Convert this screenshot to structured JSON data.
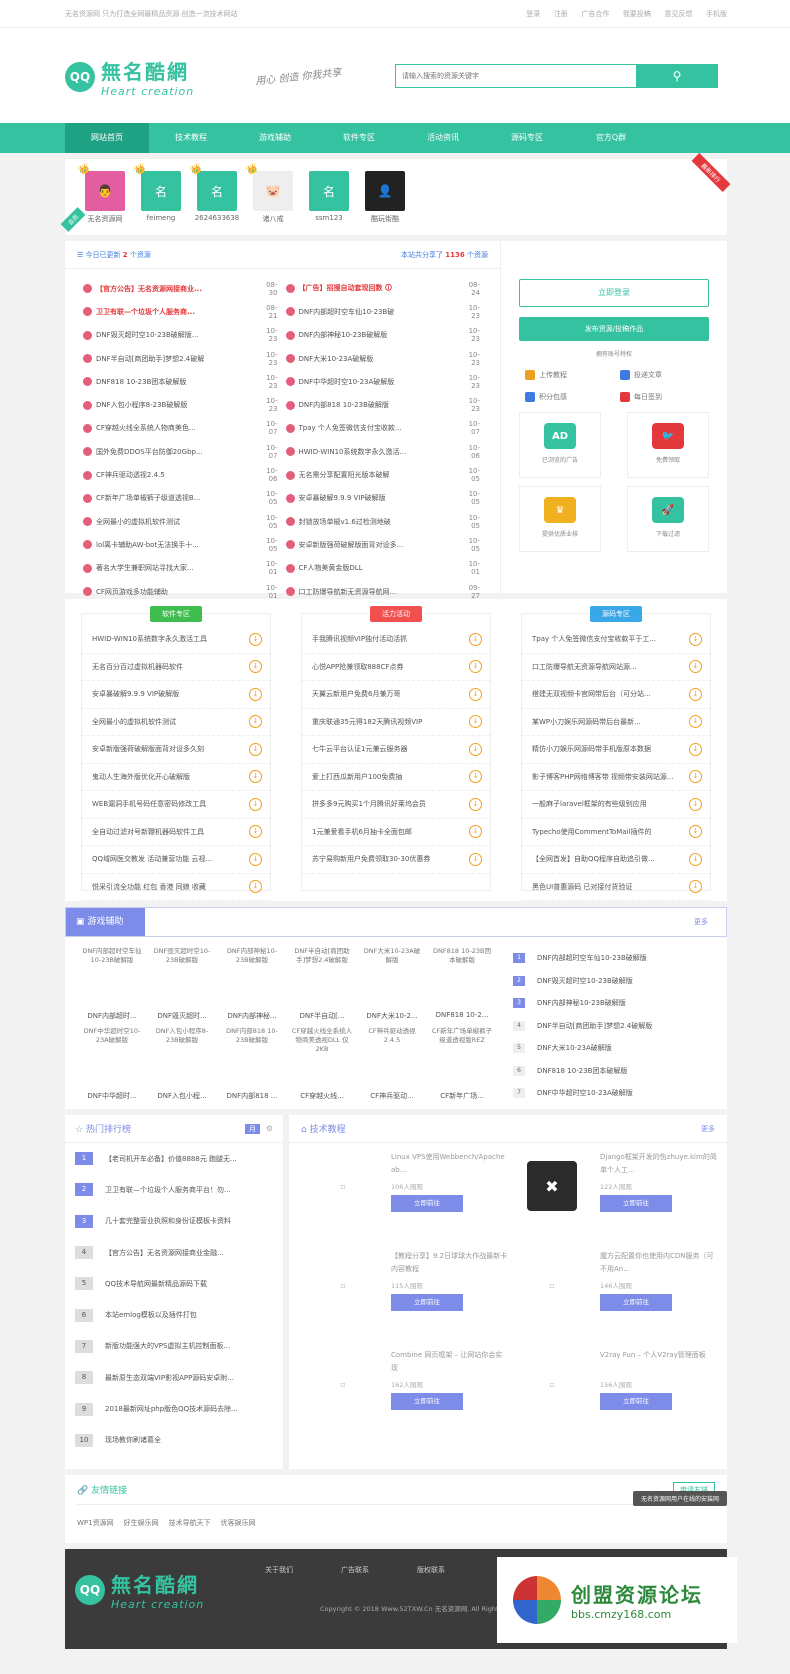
{
  "topbar": {
    "slogan": "无名资源网 只为打造全网最精品资源 创造一流技术网站",
    "links": [
      "登录",
      "注册",
      "广告合作",
      "我要投稿",
      "意见反馈",
      "手机版"
    ]
  },
  "logo": {
    "badge": "QQ",
    "cn": "無名酷網",
    "en": "Heart creation"
  },
  "motto": "用心 创造 你我共享",
  "search": {
    "placeholder": "请输入搜索的资源关键字",
    "icon": "search-icon"
  },
  "nav": {
    "items": [
      "网站首页",
      "技术教程",
      "游戏辅助",
      "软件专区",
      "活动资讯",
      "源码专区",
      "官方Q群"
    ],
    "active": 0
  },
  "users": {
    "ribbon": "最新排行",
    "corner": "会员",
    "items": [
      {
        "name": "无名资源网",
        "avatar": "👨"
      },
      {
        "name": "feimeng",
        "avatar": "名"
      },
      {
        "name": "2624633638",
        "avatar": "名"
      },
      {
        "name": "诸八戒",
        "avatar": "🐷"
      },
      {
        "name": "ssm123",
        "avatar": "名"
      },
      {
        "name": "酷玩街酷",
        "avatar": "👤"
      }
    ]
  },
  "update": {
    "today_prefix": "今日已更新",
    "today_count": "2",
    "today_suffix": "个资源",
    "total_prefix": "本站共分享了",
    "total_count": "1136",
    "total_suffix": "个资源",
    "left": [
      {
        "t": "【官方公告】无名资源网接商业...",
        "d": "08-30",
        "red": true
      },
      {
        "t": "卫卫有联—个垃圾个人服务商...",
        "d": "08-21",
        "red": true
      },
      {
        "t": "DNF毁灭超时空10-23B破解版...",
        "d": "10-23"
      },
      {
        "t": "DNF半自动[商团助手]梦想2.4破解",
        "d": "10-23"
      },
      {
        "t": "DNF818 10-23B团本破解版",
        "d": "10-23"
      },
      {
        "t": "DNF入包小程序8-23B破解版",
        "d": "10-23"
      },
      {
        "t": "CF穿越火线全系统人物商美色...",
        "d": "10-07"
      },
      {
        "t": "国外免费DDOS平台防御20Gbp...",
        "d": "10-07"
      },
      {
        "t": "CF神兵驱动透视2.4.5",
        "d": "10-06"
      },
      {
        "t": "CF新年广场单椒裤子级道透视B...",
        "d": "10-05"
      },
      {
        "t": "全网最小的虚拟机软件测试",
        "d": "10-05"
      },
      {
        "t": "lol离卡辅助AW-bot无法换手十...",
        "d": "10-05"
      },
      {
        "t": "著名大学生兼职网站寻找大家...",
        "d": "10-01"
      },
      {
        "t": "CF网页游戏多功能辅助",
        "d": "10-01"
      }
    ],
    "right": [
      {
        "t": "【广告】招搜自动套现回数 🛈",
        "d": "08-24",
        "red": true
      },
      {
        "t": "DNF内部超时空车仙10-23B破",
        "d": "10-23"
      },
      {
        "t": "DNF内部神秘10-23B破解版",
        "d": "10-23"
      },
      {
        "t": "DNF大米10-23A破解版",
        "d": "10-23"
      },
      {
        "t": "DNF中华超时空10-23A破解版",
        "d": "10-23"
      },
      {
        "t": "DNF内部818 10-23B破解版",
        "d": "10-23"
      },
      {
        "t": "Tpay 个人免签微信支付宝收款...",
        "d": "10-07"
      },
      {
        "t": "HWID-WIN10系统数字永久激活...",
        "d": "10-06"
      },
      {
        "t": "无名需分享配置阳光版本破解",
        "d": "10-05"
      },
      {
        "t": "安卓暴破解9.9.9 VIP破解版",
        "d": "10-05"
      },
      {
        "t": "封锁放场单椒v1.6过检测地破",
        "d": "10-05"
      },
      {
        "t": "安卓新版强荷破解版面背对设多...",
        "d": "10-05"
      },
      {
        "t": "CF人物美黄金版DLL",
        "d": "10-01"
      },
      {
        "t": "口工防爆导航新无资源导航网...",
        "d": "09-27"
      }
    ]
  },
  "member": {
    "login": "立即登录",
    "submit": "发布资源/投稿作品",
    "privilege": "拥有账号特权",
    "links": [
      {
        "t": "上传教程",
        "c": "#f0a020"
      },
      {
        "t": "投递文章",
        "c": "#3e7be0"
      },
      {
        "t": "积分包感",
        "c": "#3e7be0"
      },
      {
        "t": "每日签到",
        "c": "#e4393c"
      }
    ],
    "tiles": [
      {
        "t": "已浏览的广告",
        "icon": "AD",
        "c": "#35c2a0"
      },
      {
        "t": "免费领取",
        "icon": "🐦",
        "c": "#e4393c"
      },
      {
        "t": "提供优质业核",
        "icon": "♛",
        "c": "#f0b020"
      },
      {
        "t": "下载过滤",
        "icon": "🚀",
        "c": "#35c2a0"
      }
    ]
  },
  "tri": [
    {
      "tag": "软件专区",
      "color": "#3fbd4e",
      "items": [
        "HWID-WIN10系统数字永久激活工具",
        "无名百分百过虚拟机器码软件",
        "安卓暴破解9.9.9 VIP破解版",
        "全网最小的虚拟机软件测试",
        "安卓新版强荷破解版面背对设多久刻",
        "鬼动人生海外版优化开心破解版",
        "WEB漏洞手机号码任意密码修改工具",
        "全自动过滤对号新鞭机器码软件工具",
        "QQ域网医交教发 活动兼营功能 云视...",
        "悦采引流全功能 红包 香港 同娘 收藏"
      ]
    },
    {
      "tag": "活力活动",
      "color": "#f05050",
      "items": [
        "手我腾讯视频VIP独付活动活抓",
        "心悦APP抢兼领取888CF点券",
        "天翼云新用户免费6月兼万哥",
        "重庆联通35元得182天腾讯视频VIP",
        "七牛云平台认证1元兼云服务器",
        "爱上打西瓜新用户100免费抽",
        "拼多多9元购买1个月腾讯好莱坞会员",
        "1元兼爱看手机6月抽卡全面包邮",
        "苏宁易购新用户免费领取30-30优惠券"
      ]
    },
    {
      "tag": "源码专区",
      "color": "#3aa7e8",
      "items": [
        "Tpay 个人免签微信支付宝收款平于工...",
        "口工防爆导航无资源导航网站源...",
        "搭建无双视频卡官网带后台（可分站...",
        "某WP小刀娱乐网源码带后台最新...",
        "精仿小刀娱乐网源码带手机版原本数据",
        "影子博客PHP网络博客带 视频带安装网站源...",
        "一般麻子laravel框架的有些级别应用",
        "Typecho使用CommentToMail插件的",
        "【全网首发】自助QQ程序自助追引做...",
        "黑色UI普惠源码 已对接付货验证"
      ]
    }
  ],
  "game": {
    "title": "游戏辅助",
    "more": "更多",
    "grid": [
      {
        "alt": "DNF内部超时空车仙10-23B破解版",
        "name": "DNF内部超时..."
      },
      {
        "alt": "DNF毁灭超时空10-23B破解版",
        "name": "DNF毁灭超时..."
      },
      {
        "alt": "DNF内部神秘10-23B破解版",
        "name": "DNF内部神秘..."
      },
      {
        "alt": "DNF半自动[商团助手]梦想2.4破解版",
        "name": "DNF半自动[..."
      },
      {
        "alt": "DNF大米10-23A破解版",
        "name": "DNF大米10-2..."
      },
      {
        "alt": "DNF818 10-23B团本破解版",
        "name": "DNF818 10-2..."
      },
      {
        "alt": "DNF中华超时空10-23A破解版",
        "name": "DNF中华超时..."
      },
      {
        "alt": "DNF入包小程序8-23B破解版",
        "name": "DNF入包小程..."
      },
      {
        "alt": "DNF内部818 10-23B破解版",
        "name": "DNF内部818 ..."
      },
      {
        "alt": "CF穿越火线全系统人物商美透视DLL 仅2KB",
        "name": "CF穿越火线..."
      },
      {
        "alt": "CF神兵驱动透视2.4.5",
        "name": "CF神兵驱动..."
      },
      {
        "alt": "CF新年广场单椒裤子级道透视版REZ",
        "name": "CF新年广场..."
      }
    ],
    "list": [
      "DNF内部超时空车仙10-23B破解版",
      "DNF毁灭超时空10-23B破解版",
      "DNF内部神秘10-23B破解版",
      "DNF半自动[商团助手]梦想2.4破解版",
      "DNF大米10-23A破解版",
      "DNF818 10-23B团本破解版",
      "DNF中华超时空10-23A破解版"
    ]
  },
  "hot": {
    "title": "热门排行榜",
    "tab": "月",
    "items": [
      "【老司机开车必备】价值8888元 跑腿无...",
      "卫卫有联—个垃圾个人服务商平台！勿...",
      "几十套完整营业执照和身份证模板卡资料",
      "【官方公告】无名资源网接商业金融...",
      "QQ技术导航网最新精品源码下载",
      "本站emlog模板以及插件打包",
      "新版功能强大的VPS虚拟主机控制面板...",
      "最新原生态双端VIP影视APP源码安卓附...",
      "2018最新网址php版色QQ技术源码去除...",
      "现场教你刷诸葛全"
    ]
  },
  "tech": {
    "title": "技术教程",
    "more": "更多",
    "go": "立即前往",
    "items": [
      {
        "t": "Linux VPS使用Webbench/Apache ab...",
        "v": "106人围观",
        "broken": true
      },
      {
        "t": "Django框架开发的伤zhuye.kim的简单个人工...",
        "v": "122人围观",
        "broken": false
      },
      {
        "t": "【教程分享】9.2日球球大作战最新卡内容教程",
        "v": "115人围观",
        "broken": true
      },
      {
        "t": "魔方云配置你也使用内CDN服务（可不用An...",
        "v": "146人围观",
        "broken": true
      },
      {
        "t": "Combine 网页框架 – 让网站你会实现",
        "v": "162人围观",
        "broken": true
      },
      {
        "t": "V2ray Fun – 个人V2ray管理面板",
        "v": "156人围观",
        "broken": true
      }
    ]
  },
  "friend": {
    "title": "友情链接",
    "apply": "申请友链",
    "links": [
      "WP1资源网",
      "好生娱乐网",
      "技术导航天下",
      "优客娱乐网"
    ]
  },
  "footer": {
    "links": [
      "关于我们",
      "广告联系",
      "版权联系"
    ],
    "copy": "Copyright © 2018 Www.52TXW.Cn 无名资源网. All Rights Reserved.",
    "toast": "无名资源网用户在线的安装网",
    "watermark_cn": "创盟资源论坛",
    "watermark_url": "bbs.cmzy168.com"
  }
}
